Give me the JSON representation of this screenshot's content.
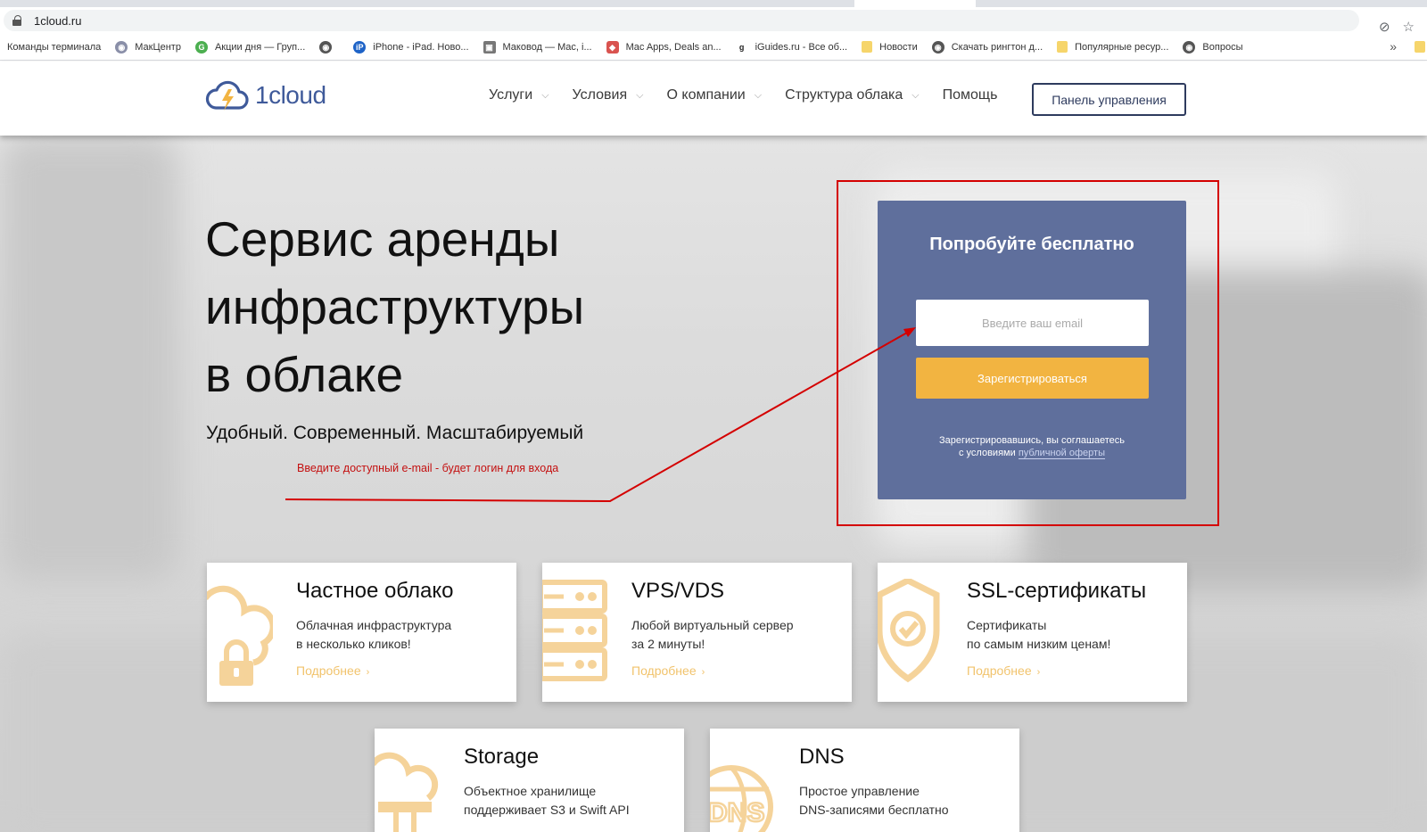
{
  "browser": {
    "url": "1cloud.ru",
    "bookmarks": [
      {
        "label": "Команды терминала",
        "icon": "none"
      },
      {
        "label": "МакЦентр",
        "icon": "globe-icon"
      },
      {
        "label": "Акции дня — Груп...",
        "icon": "g-icon"
      },
      {
        "label": "",
        "icon": "globe-icon"
      },
      {
        "label": "iPhone - iPad. Ново...",
        "icon": "ip-icon"
      },
      {
        "label": "Маковод — Mac, i...",
        "icon": "image-icon"
      },
      {
        "label": "Mac Apps, Deals an...",
        "icon": "box-icon"
      },
      {
        "label": "iGuides.ru - Все об...",
        "icon": "g-icon"
      },
      {
        "label": "Новости",
        "icon": "folder-icon"
      },
      {
        "label": "Скачать рингтон д...",
        "icon": "globe-icon"
      },
      {
        "label": "Популярные ресур...",
        "icon": "folder-icon"
      },
      {
        "label": "Вопросы",
        "icon": "globe-icon"
      }
    ],
    "more": "»"
  },
  "header": {
    "logo_text": "1cloud",
    "nav": [
      {
        "label": "Услуги",
        "dropdown": true
      },
      {
        "label": "Условия",
        "dropdown": true
      },
      {
        "label": "О компании",
        "dropdown": true
      },
      {
        "label": "Структура облака",
        "dropdown": true
      },
      {
        "label": "Помощь",
        "dropdown": false
      }
    ],
    "panel_button": "Панель управления"
  },
  "hero": {
    "title_lines": [
      "Сервис аренды",
      "инфраструктуры",
      "в облаке"
    ],
    "subtitle": "Удобный. Современный. Масштабируемый",
    "annotation": "Введите доступный e-mail - будет логин для входа"
  },
  "signup": {
    "title": "Попробуйте бесплатно",
    "email_placeholder": "Введите ваш email",
    "email_value": "",
    "register_button": "Зарегистрироваться",
    "terms_line1": "Зарегистрировавшись, вы соглашаетесь",
    "terms_line2": "с условиями",
    "terms_link": "публичной оферты"
  },
  "cards": [
    {
      "title": "Частное облако",
      "desc1": "Облачная инфраструктура",
      "desc2": "в несколько кликов!",
      "more": "Подробнее",
      "icon": "cloud-lock-icon"
    },
    {
      "title": "VPS/VDS",
      "desc1": "Любой виртуальный сервер",
      "desc2": "за 2 минуты!",
      "more": "Подробнее",
      "icon": "server-icon"
    },
    {
      "title": "SSL-сертификаты",
      "desc1": "Сертификаты",
      "desc2": "по самым низким ценам!",
      "more": "Подробнее",
      "icon": "shield-check-icon"
    },
    {
      "title": "Storage",
      "desc1": "Объектное хранилище",
      "desc2": "поддерживает S3 и Swift API",
      "more": "",
      "icon": "cloud-storage-icon"
    },
    {
      "title": "DNS",
      "desc1": "Простое управление",
      "desc2": "DNS-записями бесплатно",
      "more": "",
      "icon": "dns-globe-icon"
    }
  ],
  "colors": {
    "brand_blue": "#3f5a9a",
    "card_blue": "#5f6f9c",
    "accent_orange": "#f2b441",
    "icon_orange": "#f1c36c",
    "annotation_red": "#d40000"
  }
}
